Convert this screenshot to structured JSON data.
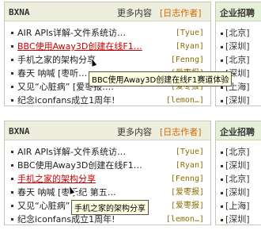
{
  "panels": [
    {
      "header": {
        "title": "BXNA",
        "more": "更多内容",
        "daily": "[日志作者]"
      },
      "items": [
        {
          "title": "AIR APIs详解-文件系统访…",
          "author": "[Tyue]"
        },
        {
          "title": "BBC使用Away3D创建在线F1…",
          "author": "[Ryan]"
        },
        {
          "title": "手机之家的架构分享",
          "author": "[Fenng]"
        },
        {
          "title": "春天  呐喊 [枣听…",
          "author": "[爱枣报]"
        },
        {
          "title": "又见“心脏病” [爱枣报:…",
          "author": "[爱枣报]"
        },
        {
          "title": "纪念iconfans成立1周年!",
          "author": "[lemon…]"
        }
      ],
      "side": {
        "title": "企业招聘",
        "items": [
          "[北京]",
          "[深圳]",
          "[北京]",
          "[深圳]",
          "[上海]",
          "[深圳]"
        ]
      },
      "tooltip": "BBC使用Away3D创建在线F1赛道体验"
    },
    {
      "header": {
        "title": "BXNA",
        "more": "更多内容",
        "daily": "[日志作者]"
      },
      "items": [
        {
          "title": "AIR APIs详解-文件系统访…",
          "author": "[Tyue]"
        },
        {
          "title": "BBC使用Away3D创建在线F1…",
          "author": "[Ryan]"
        },
        {
          "title": "手机之家的架构分享",
          "author": "[Fenng]"
        },
        {
          "title": "春天  呐喊 [枣乐纪 第五…",
          "author": "[爱枣报]"
        },
        {
          "title": "又见“心脏病” [爱枣报:…",
          "author": "[爱枣报]"
        },
        {
          "title": "纪念iconfans成立1周年!",
          "author": "[lemon…]"
        }
      ],
      "side": {
        "title": "企业招聘",
        "items": [
          "[北京]",
          "[深圳]",
          "[北京]",
          "[深圳]",
          "[上海]",
          "[深圳]"
        ]
      },
      "tooltip": "手机之家的架构分享"
    }
  ],
  "colors": {
    "active_link": "#cc0000",
    "author": "#8a6d00",
    "daily_link": "#d06a00",
    "tooltip_bg": "#ffffe1"
  }
}
